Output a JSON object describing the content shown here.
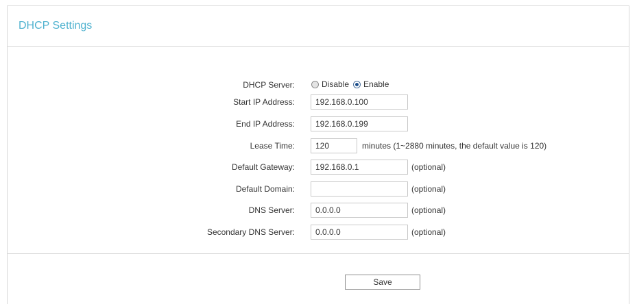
{
  "header": {
    "title": "DHCP Settings"
  },
  "form": {
    "dhcp_server": {
      "label": "DHCP Server:",
      "options": [
        "Disable",
        "Enable"
      ],
      "selected": "Enable"
    },
    "start_ip": {
      "label": "Start IP Address:",
      "value": "192.168.0.100"
    },
    "end_ip": {
      "label": "End IP Address:",
      "value": "192.168.0.199"
    },
    "lease_time": {
      "label": "Lease Time:",
      "value": "120",
      "note": "minutes (1~2880 minutes, the default value is 120)"
    },
    "default_gateway": {
      "label": "Default Gateway:",
      "value": "192.168.0.1",
      "note": "(optional)"
    },
    "default_domain": {
      "label": "Default Domain:",
      "value": "",
      "note": "(optional)"
    },
    "dns_server": {
      "label": "DNS Server:",
      "value": "0.0.0.0",
      "note": "(optional)"
    },
    "secondary_dns": {
      "label": "Secondary DNS Server:",
      "value": "0.0.0.0",
      "note": "(optional)"
    }
  },
  "actions": {
    "save_label": "Save"
  },
  "colors": {
    "title": "#4fb2cf",
    "border": "#d8d8d8",
    "radio_checked": "#1d4f8c"
  },
  "icons": {
    "radio_unchecked": "radio-unchecked-icon",
    "radio_checked": "radio-checked-icon"
  }
}
